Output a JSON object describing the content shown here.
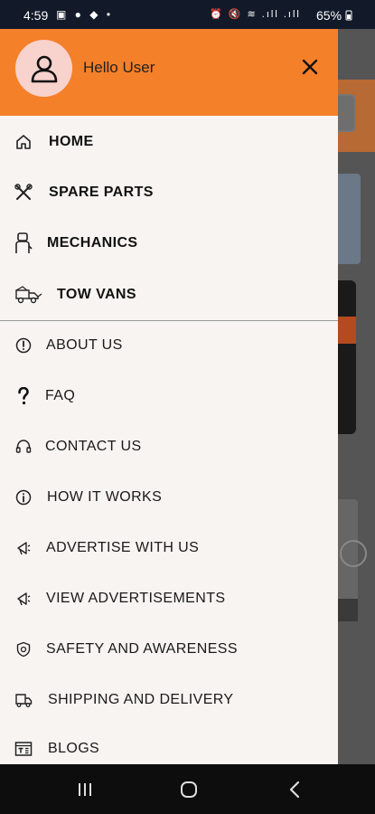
{
  "status_bar": {
    "time": "4:59",
    "left_icons": "▣ ● ◆ •",
    "right_icons": "⏰ 🔇 ≋ .ıll .ıll",
    "battery": "65%"
  },
  "drawer": {
    "greeting": "Hello User",
    "primary_items": [
      {
        "label": "HOME",
        "icon": "home-icon"
      },
      {
        "label": "SPARE PARTS",
        "icon": "tools-icon"
      },
      {
        "label": "MECHANICS",
        "icon": "mechanic-icon"
      },
      {
        "label": "TOW VANS",
        "icon": "tow-truck-icon"
      }
    ],
    "secondary_items": [
      {
        "label": "ABOUT US",
        "icon": "info-icon"
      },
      {
        "label": "FAQ",
        "icon": "question-icon"
      },
      {
        "label": "CONTACT US",
        "icon": "headset-icon"
      },
      {
        "label": "HOW IT WORKS",
        "icon": "info-circle-icon"
      },
      {
        "label": "ADVERTISE WITH US",
        "icon": "megaphone-icon"
      },
      {
        "label": "VIEW ADVERTISEMENTS",
        "icon": "megaphone-icon"
      },
      {
        "label": "SAFETY AND AWARENESS",
        "icon": "shield-icon"
      },
      {
        "label": "SHIPPING AND DELIVERY",
        "icon": "delivery-truck-icon"
      },
      {
        "label": "BLOGS",
        "icon": "blog-icon"
      }
    ]
  },
  "colors": {
    "header": "#f5802a",
    "drawer_bg": "#f7f4f1",
    "avatar_bg": "#f8d2cc"
  }
}
